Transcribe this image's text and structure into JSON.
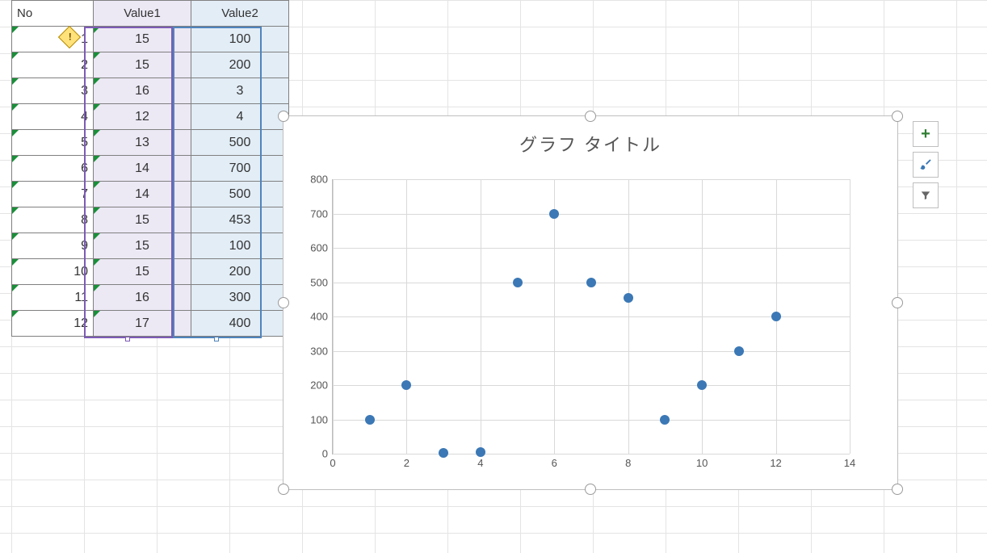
{
  "table": {
    "headers": {
      "no": "No",
      "v1": "Value1",
      "v2": "Value2"
    },
    "rows": [
      {
        "no": "1",
        "v1": "15",
        "v2": "100"
      },
      {
        "no": "2",
        "v1": "15",
        "v2": "200"
      },
      {
        "no": "3",
        "v1": "16",
        "v2": "3"
      },
      {
        "no": "4",
        "v1": "12",
        "v2": "4"
      },
      {
        "no": "5",
        "v1": "13",
        "v2": "500"
      },
      {
        "no": "6",
        "v1": "14",
        "v2": "700"
      },
      {
        "no": "7",
        "v1": "14",
        "v2": "500"
      },
      {
        "no": "8",
        "v1": "15",
        "v2": "453"
      },
      {
        "no": "9",
        "v1": "15",
        "v2": "100"
      },
      {
        "no": "10",
        "v1": "15",
        "v2": "200"
      },
      {
        "no": "11",
        "v1": "16",
        "v2": "300"
      },
      {
        "no": "12",
        "v1": "17",
        "v2": "400"
      }
    ]
  },
  "chart_title": "グラフ タイトル",
  "chart_data": {
    "type": "scatter",
    "title": "グラフ タイトル",
    "xlabel": "",
    "ylabel": "",
    "xlim": [
      0,
      14
    ],
    "ylim": [
      0,
      800
    ],
    "xticks": [
      0,
      2,
      4,
      6,
      8,
      10,
      12,
      14
    ],
    "yticks": [
      0,
      100,
      200,
      300,
      400,
      500,
      600,
      700,
      800
    ],
    "series": [
      {
        "name": "Value2",
        "x": [
          1,
          2,
          3,
          4,
          5,
          6,
          7,
          8,
          9,
          10,
          11,
          12
        ],
        "y": [
          100,
          200,
          3,
          4,
          500,
          700,
          500,
          453,
          100,
          200,
          300,
          400
        ]
      }
    ]
  },
  "icons": {
    "plus": "plus-icon",
    "brush": "brush-icon",
    "funnel": "filter-icon",
    "warn": "error-warning-icon"
  },
  "warn_glyph": "!"
}
